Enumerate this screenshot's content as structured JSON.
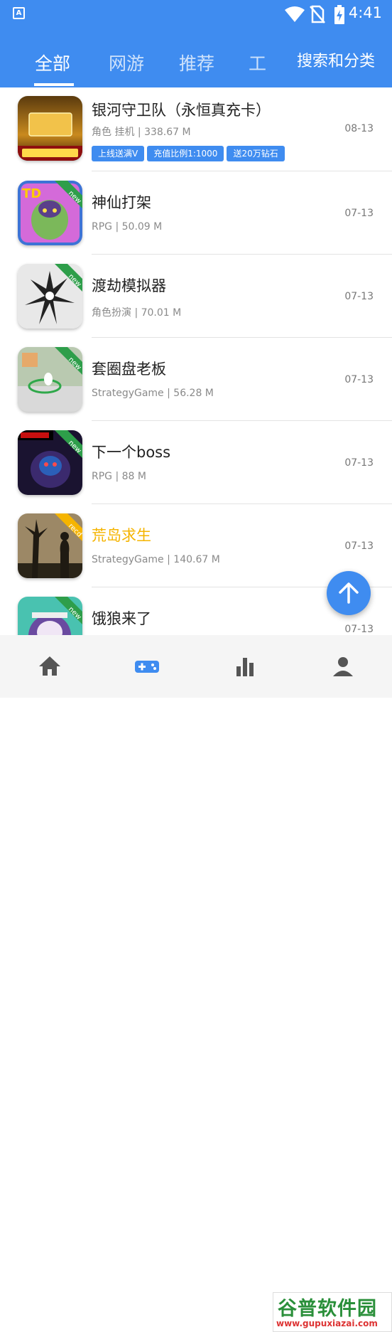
{
  "status_bar": {
    "app_badge": "A",
    "time": "4:41"
  },
  "tabs": [
    {
      "label": "全部",
      "active": true
    },
    {
      "label": "网游",
      "active": false
    },
    {
      "label": "推荐",
      "active": false
    },
    {
      "label": "工",
      "active": false
    }
  ],
  "search_category_label": "搜索和分类",
  "games": [
    {
      "name": "银河守卫队（永恒真充卡）",
      "meta": "角色 挂机 | 338.67 M",
      "date": "08-13",
      "tags": [
        "上线送满V",
        "充值比例1:1000",
        "送20万钻石"
      ],
      "icon": "galaxy-game-icon"
    },
    {
      "name": "神仙打架",
      "meta": "RPG | 50.09 M",
      "date": "07-13",
      "ribbon": "new",
      "icon": "shenxian-game-icon"
    },
    {
      "name": "渡劫模拟器",
      "meta": "角色扮演 | 70.01 M",
      "date": "07-13",
      "ribbon": "new",
      "icon": "dujie-game-icon"
    },
    {
      "name": "套圈盘老板",
      "meta": "StrategyGame | 56.28 M",
      "date": "07-13",
      "ribbon": "new",
      "icon": "taoquan-game-icon"
    },
    {
      "name": "下一个boss",
      "meta": "RPG | 88 M",
      "date": "07-13",
      "ribbon": "new",
      "icon": "nextboss-game-icon"
    },
    {
      "name": "荒岛求生",
      "meta": "StrategyGame | 140.67 M",
      "date": "07-13",
      "ribbon": "recd",
      "icon": "survival-game-icon"
    },
    {
      "name": "饿狼来了",
      "meta": "",
      "date": "07-13",
      "ribbon": "new",
      "icon": "wolf-game-icon"
    }
  ],
  "watermark": {
    "title": "谷普软件园",
    "url": "www.gupuxiazai.com"
  },
  "colors": {
    "accent": "#3F8CF0",
    "highlight": "#F5B400",
    "ribbon_new": "#2E9E4A",
    "ribbon_recd": "#F5B400"
  }
}
